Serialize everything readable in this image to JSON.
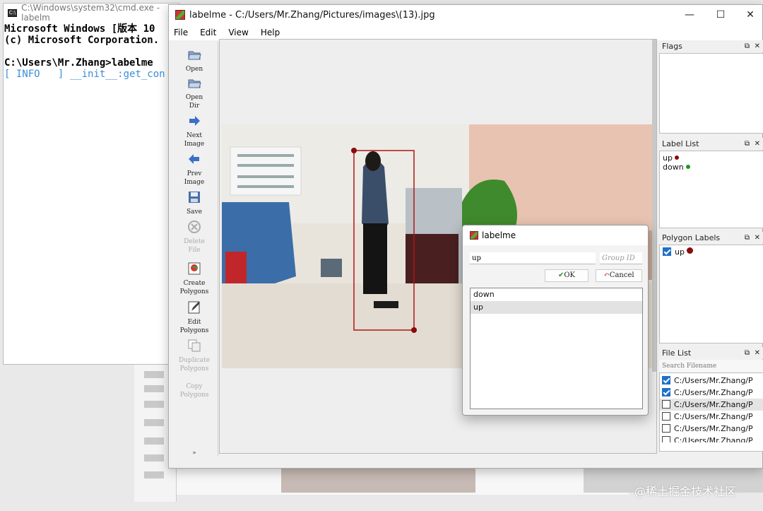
{
  "cmd": {
    "title": "C:\\Windows\\system32\\cmd.exe - labelm",
    "line1": "Microsoft Windows [版本 10",
    "line2": "(c) Microsoft Corporation.",
    "line3": "C:\\Users\\Mr.Zhang>labelme",
    "line4a": "[ INFO   ]",
    "line4b": " __init__:get_con"
  },
  "labelme": {
    "title": "labelme - C:/Users/Mr.Zhang/Pictures/images\\(13).jpg",
    "menu": [
      "File",
      "Edit",
      "View",
      "Help"
    ],
    "toolbar": [
      {
        "label": "Open",
        "icon": "folder-open-icon"
      },
      {
        "label": "Open\nDir",
        "icon": "folder-open-icon"
      },
      {
        "label": "Next\nImage",
        "icon": "arrow-right-icon"
      },
      {
        "label": "Prev\nImage",
        "icon": "arrow-left-icon"
      },
      {
        "label": "Save",
        "icon": "save-icon"
      },
      {
        "label": "Delete\nFile",
        "icon": "delete-icon"
      },
      {
        "label": "Create\nPolygons",
        "icon": "create-polygon-icon"
      },
      {
        "label": "Edit\nPolygons",
        "icon": "edit-icon"
      },
      {
        "label": "Duplicate\nPolygons",
        "icon": "duplicate-icon"
      },
      {
        "label": "Copy\nPolygons",
        "icon": "copy-icon"
      }
    ],
    "more": "»"
  },
  "docks": {
    "flags": "Flags",
    "label_list": "Label List",
    "labels": [
      {
        "name": "up",
        "color": "#8b0a0a"
      },
      {
        "name": "down",
        "color": "#1a9a1a"
      }
    ],
    "polygon_labels": "Polygon Labels",
    "polygons": [
      {
        "name": "up",
        "color": "#8b0a0a",
        "checked": true
      }
    ],
    "file_list": "File List",
    "search_placeholder": "Search Filename",
    "files": [
      {
        "path": "C:/Users/Mr.Zhang/P",
        "checked": true
      },
      {
        "path": "C:/Users/Mr.Zhang/P",
        "checked": true
      },
      {
        "path": "C:/Users/Mr.Zhang/P",
        "checked": false
      },
      {
        "path": "C:/Users/Mr.Zhang/P",
        "checked": false
      },
      {
        "path": "C:/Users/Mr.Zhang/P",
        "checked": false
      },
      {
        "path": "C:/Users/Mr.Zhang/P",
        "checked": false
      }
    ]
  },
  "dialog": {
    "title": "labelme",
    "label_value": "up",
    "group_placeholder": "Group ID",
    "ok": "OK",
    "cancel": "Cancel",
    "items": [
      "down",
      "up"
    ],
    "selected": "up"
  },
  "watermark": "@稀土掘金技术社区"
}
